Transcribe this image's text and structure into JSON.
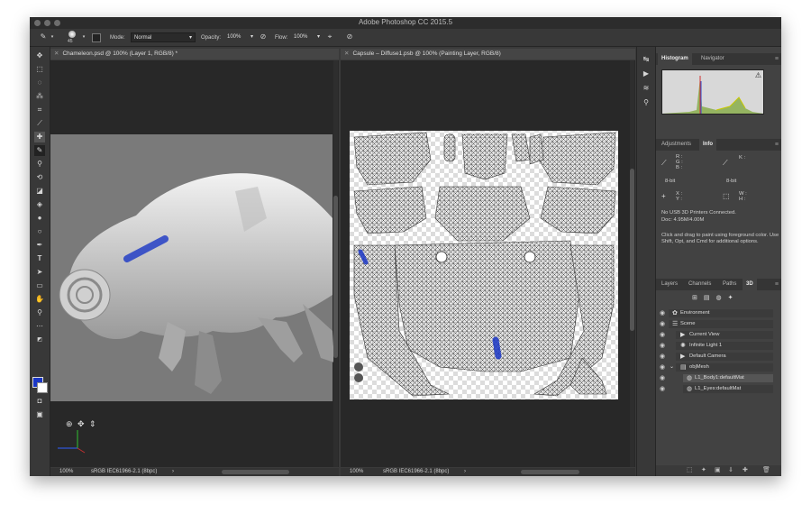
{
  "app": {
    "title": "Adobe Photoshop CC 2015.5"
  },
  "options_bar": {
    "brush_size": "45",
    "mode_label": "Mode:",
    "mode_value": "Normal",
    "opacity_label": "Opacity:",
    "opacity_value": "100%",
    "flow_label": "Flow:",
    "flow_value": "100%"
  },
  "documents": [
    {
      "tab_title": "Chameleon.psd @ 100% (Layer 1, RGB/8) *",
      "zoom": "100%",
      "profile": "sRGB IEC61966-2.1 (8bpc)"
    },
    {
      "tab_title": "Capsule – Diffuse1.psb @ 100% (Painting Layer, RGB/8)",
      "zoom": "100%",
      "profile": "sRGB IEC61966-2.1 (8bpc)"
    }
  ],
  "panels": {
    "histogram": {
      "tabs": [
        "Histogram",
        "Navigator"
      ]
    },
    "info": {
      "tabs": [
        "Adjustments",
        "Info"
      ],
      "rgb_labels": [
        "R :",
        "G :",
        "B :"
      ],
      "k_label": "K :",
      "bit_left": "8-bit",
      "bit_right": "8-bit",
      "xy_labels": [
        "X :",
        "Y :"
      ],
      "wh_labels": [
        "W :",
        "H :"
      ],
      "status_line1": "No USB 3D Printers Connected.",
      "status_line2": "Doc: 4.95M/4.00M",
      "hint": "Click and drag to paint using foreground color. Use Shift, Opt, and Cmd for additional options."
    },
    "layers": {
      "tabs": [
        "Layers",
        "Channels",
        "Paths",
        "3D"
      ],
      "items": [
        {
          "label": "Environment"
        },
        {
          "label": "Scene"
        },
        {
          "label": "Current View"
        },
        {
          "label": "Infinite Light 1"
        },
        {
          "label": "Default Camera"
        },
        {
          "label": "objMesh"
        },
        {
          "label": "L1_Body1:defaultMat"
        },
        {
          "label": "L1_Eyes:defaultMat"
        }
      ]
    }
  },
  "colors": {
    "foreground": "#1b37c6",
    "background": "#ffffff"
  }
}
